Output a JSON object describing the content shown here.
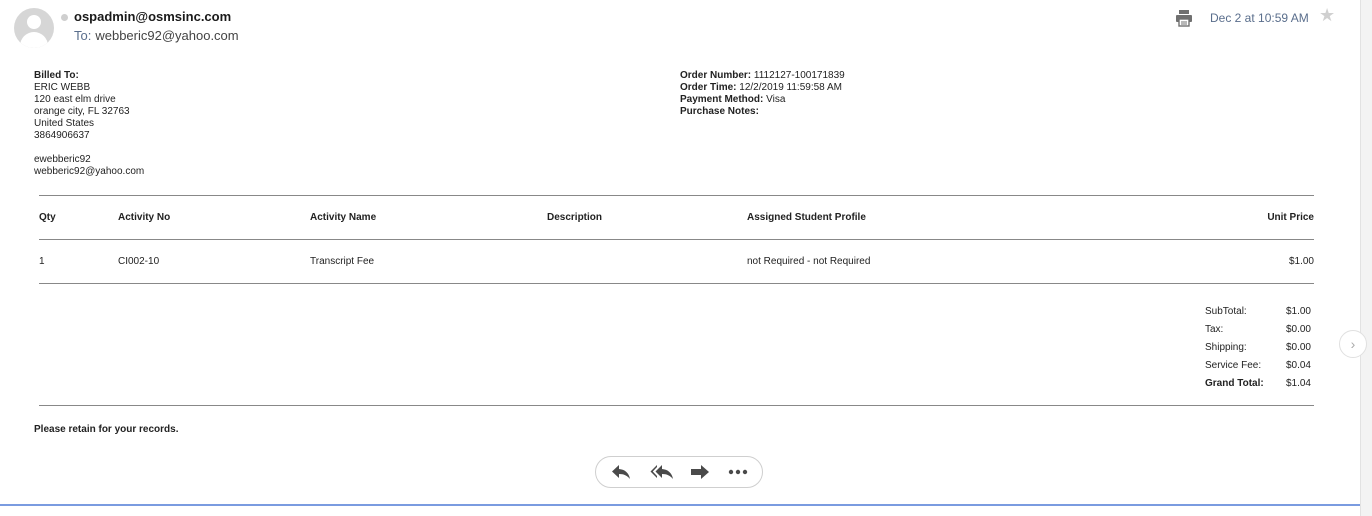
{
  "header": {
    "sender": "ospadmin@osmsinc.com",
    "to_label": "To:",
    "to_value": "webberic92@yahoo.com",
    "date": "Dec 2 at 10:59 AM"
  },
  "billing": {
    "label": "Billed To:",
    "name": "ERIC WEBB",
    "street": "120 east elm drive",
    "city": "orange city, FL 32763",
    "country": "United States",
    "phone": "3864906637",
    "username": "ewebberic92",
    "email": "webberic92@yahoo.com"
  },
  "order": {
    "number_label": "Order Number:",
    "number": "1112127-100171839",
    "time_label": "Order Time:",
    "time": "12/2/2019 11:59:58 AM",
    "payment_label": "Payment Method:",
    "payment": "Visa",
    "notes_label": "Purchase Notes:"
  },
  "table": {
    "headers": [
      "Qty",
      "Activity No",
      "Activity Name",
      "Description",
      "Assigned Student Profile",
      "Unit Price"
    ],
    "rows": [
      [
        "1",
        "CI002-10",
        "Transcript Fee",
        "",
        "not Required - not Required",
        "$1.00"
      ]
    ]
  },
  "totals": {
    "subtotal_label": "SubTotal:",
    "subtotal": "$1.00",
    "tax_label": "Tax:",
    "tax": "$0.00",
    "shipping_label": "Shipping:",
    "shipping": "$0.00",
    "service_label": "Service Fee:",
    "service": "$0.04",
    "grand_label": "Grand Total:",
    "grand": "$1.04"
  },
  "footer_note": "Please retain for your records.",
  "icons": {
    "avatar": "user-avatar-placeholder",
    "print": "printer-icon",
    "star": "star-icon",
    "reply": "reply-icon",
    "reply_all": "reply-all-icon",
    "forward": "forward-icon",
    "more": "more-icon",
    "next": "chevron-right-icon"
  }
}
